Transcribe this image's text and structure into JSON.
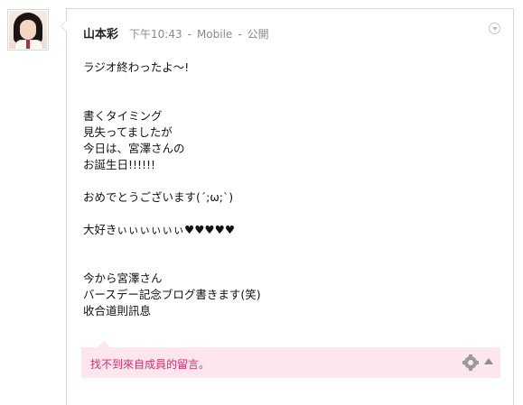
{
  "post": {
    "author": "山本彩",
    "time": "下午10:43",
    "source": "Mobile",
    "visibility": "公開",
    "separator": "-",
    "lines": [
      "ラジオ終わったよ〜!",
      "",
      "",
      "書くタイミング",
      "見失ってましたが",
      "今日は、宮澤さんの",
      "お誕生日!!!!!!",
      "",
      "おめでとうございます(´;ω;`)",
      "",
      "大好きぃぃぃぃぃぃ♥♥♥♥♥",
      "",
      "",
      "今から宮澤さん",
      "バースデー記念ブログ書きます(笑)",
      "收合道則訊息"
    ]
  },
  "comments": {
    "empty_text": "找不到來自成員的留言。"
  },
  "colors": {
    "comment_bg": "#fde6ed",
    "comment_text": "#d0306a",
    "meta_text": "#8a8a8a"
  },
  "icons": {
    "menu": "chevron-down-circle-icon",
    "settings": "gear-icon",
    "collapse": "triangle-up-icon"
  }
}
